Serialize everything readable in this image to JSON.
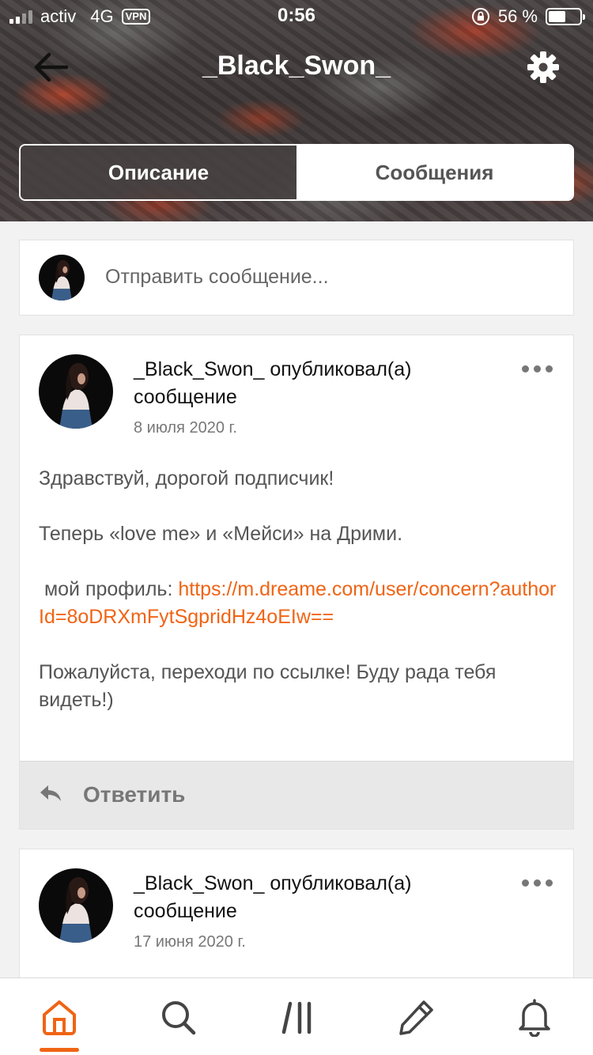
{
  "status_bar": {
    "carrier": "activ",
    "network": "4G",
    "vpn_label": "VPN",
    "time": "0:56",
    "battery_text": "56 %",
    "battery_level": 0.56
  },
  "header": {
    "title": "_Black_Swon_",
    "back_icon": "arrow-left-icon",
    "settings_icon": "gear-icon"
  },
  "tabs": [
    {
      "label": "Описание",
      "active": true
    },
    {
      "label": "Сообщения",
      "active": false
    }
  ],
  "composer": {
    "placeholder": "Отправить сообщение..."
  },
  "posts": [
    {
      "header": "_Black_Swon_ опубликовал(а) сообщение",
      "date": "8 июля 2020 г.",
      "lines": {
        "greeting": "Здравствуй, дорогой подписчик!",
        "announce": "Теперь «love me» и «Мейси» на Дрими.",
        "profile_prefix": " мой профиль: ",
        "profile_link": "https://m.dreame.com/user/concern?authorId=8oDRXmFytSgpridHz4oEIw==",
        "invite": "Пожалуйста, переходи по ссылке! Буду рада тебя видеть!)"
      },
      "reply_label": "Ответить"
    },
    {
      "header": "_Black_Swon_ опубликовал(а) сообщение",
      "date": "17 июня 2020 г."
    }
  ],
  "tabbar": {
    "items": [
      {
        "icon": "home-icon",
        "active": true
      },
      {
        "icon": "search-icon",
        "active": false
      },
      {
        "icon": "library-icon",
        "active": false
      },
      {
        "icon": "pencil-icon",
        "active": false
      },
      {
        "icon": "bell-icon",
        "active": false
      }
    ],
    "accent": "#f06414"
  }
}
